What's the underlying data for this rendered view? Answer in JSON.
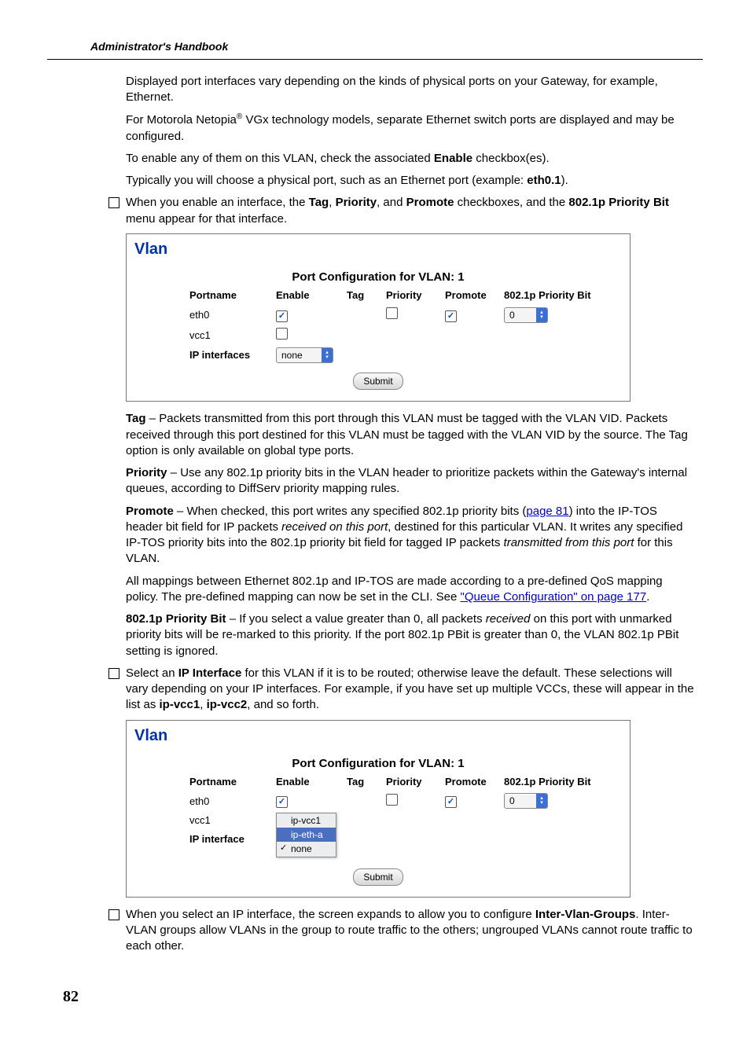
{
  "header": {
    "title": "Administrator's Handbook"
  },
  "page_number": "82",
  "body": {
    "p1": "Displayed port interfaces vary depending on the kinds of physical ports on your Gateway, for example, Ethernet.",
    "p2a": "For Motorola Netopia",
    "p2b": " VGx technology models, separate Ethernet switch ports are displayed and may be configured.",
    "p3a": "To enable any of them on this VLAN, check the associated ",
    "p3b": "Enable",
    "p3c": " checkbox(es).",
    "p4a": "Typically you will choose a physical port, such as an Ethernet port (example: ",
    "p4b": "eth0.1",
    "p4c": ").",
    "b1a": "When you enable an interface, the ",
    "b1_tag": "Tag",
    "b1_sep1": ", ",
    "b1_pri": "Priority",
    "b1_sep2": ", and ",
    "b1_pro": "Promote",
    "b1_mid": " checkboxes, and the ",
    "b1_8021p": "802.1p Priority Bit",
    "b1_end": " menu appear for that interface.",
    "tag_b": "Tag",
    "tag_t": " – Packets transmitted from this port through this VLAN must be tagged with the VLAN VID. Packets received through this port destined for this VLAN must be tagged with the VLAN VID by the source. The Tag option is only available on global type ports.",
    "pri_b": "Priority",
    "pri_t": " – Use any 802.1p priority bits in the VLAN header to prioritize packets within the Gateway's internal queues, according to DiffServ priority mapping rules.",
    "pro_b": "Promote",
    "pro_t1": " – When checked, this port writes any specified 802.1p priority bits (",
    "pro_link": "page 81",
    "pro_t2": ") into the IP-TOS header bit field for IP packets ",
    "pro_i1": "received on this port",
    "pro_t3": ", destined for this particular VLAN. It writes any specified IP-TOS priority bits into the 802.1p priority bit field for tagged IP packets ",
    "pro_i2": "transmitted from this port",
    "pro_t4": " for this VLAN.",
    "map_t1": "All mappings between Ethernet 802.1p and IP-TOS are made according to a pre-defined QoS mapping policy. The pre-defined mapping can now be set in the CLI. See ",
    "map_link": "\"Queue Configuration\" on page 177",
    "map_t2": ".",
    "pbit_b": "802.1p Priority Bit",
    "pbit_t1": " – If you select a value greater than 0, all packets ",
    "pbit_i": "received",
    "pbit_t2": " on this port with unmarked priority bits will be re-marked to this priority. If the port 802.1p PBit is greater than 0, the VLAN 802.1p PBit setting is ignored.",
    "b2a": "Select an ",
    "b2b": "IP Interface",
    "b2c": " for this VLAN if it is to be routed; otherwise leave the default. These selections will vary depending on your IP interfaces. For example, if you have set up multiple VCCs, these will appear in the list as ",
    "b2d": "ip-vcc1",
    "b2e": ", ",
    "b2f": "ip-vcc2",
    "b2g": ", and so forth.",
    "b3a": "When you select an IP interface, the screen expands to allow you to configure ",
    "b3b": "Inter-Vlan-Groups",
    "b3c": ". Inter-VLAN groups allow VLANs in the group to route traffic to the others; ungrouped VLANs cannot route traffic to each other."
  },
  "panel1": {
    "title": "Vlan",
    "subtitle": "Port Configuration for VLAN: 1",
    "headers": {
      "portname": "Portname",
      "enable": "Enable",
      "tag": "Tag",
      "priority": "Priority",
      "promote": "Promote",
      "pbit": "802.1p Priority Bit"
    },
    "rows": {
      "r1_name": "eth0",
      "r2_name": "vcc1"
    },
    "ip_label": "IP interfaces",
    "ip_value": "none",
    "pbit_value": "0",
    "submit": "Submit"
  },
  "panel2": {
    "title": "Vlan",
    "subtitle": "Port Configuration for VLAN: 1",
    "headers": {
      "portname": "Portname",
      "enable": "Enable",
      "tag": "Tag",
      "priority": "Priority",
      "promote": "Promote",
      "pbit": "802.1p Priority Bit"
    },
    "rows": {
      "r1_name": "eth0",
      "r2_name": "vcc1"
    },
    "ip_label": "IP interface",
    "dropdown": {
      "opt1": "ip-vcc1",
      "opt2": "ip-eth-a",
      "opt3": "none"
    },
    "pbit_value": "0",
    "submit": "Submit"
  }
}
